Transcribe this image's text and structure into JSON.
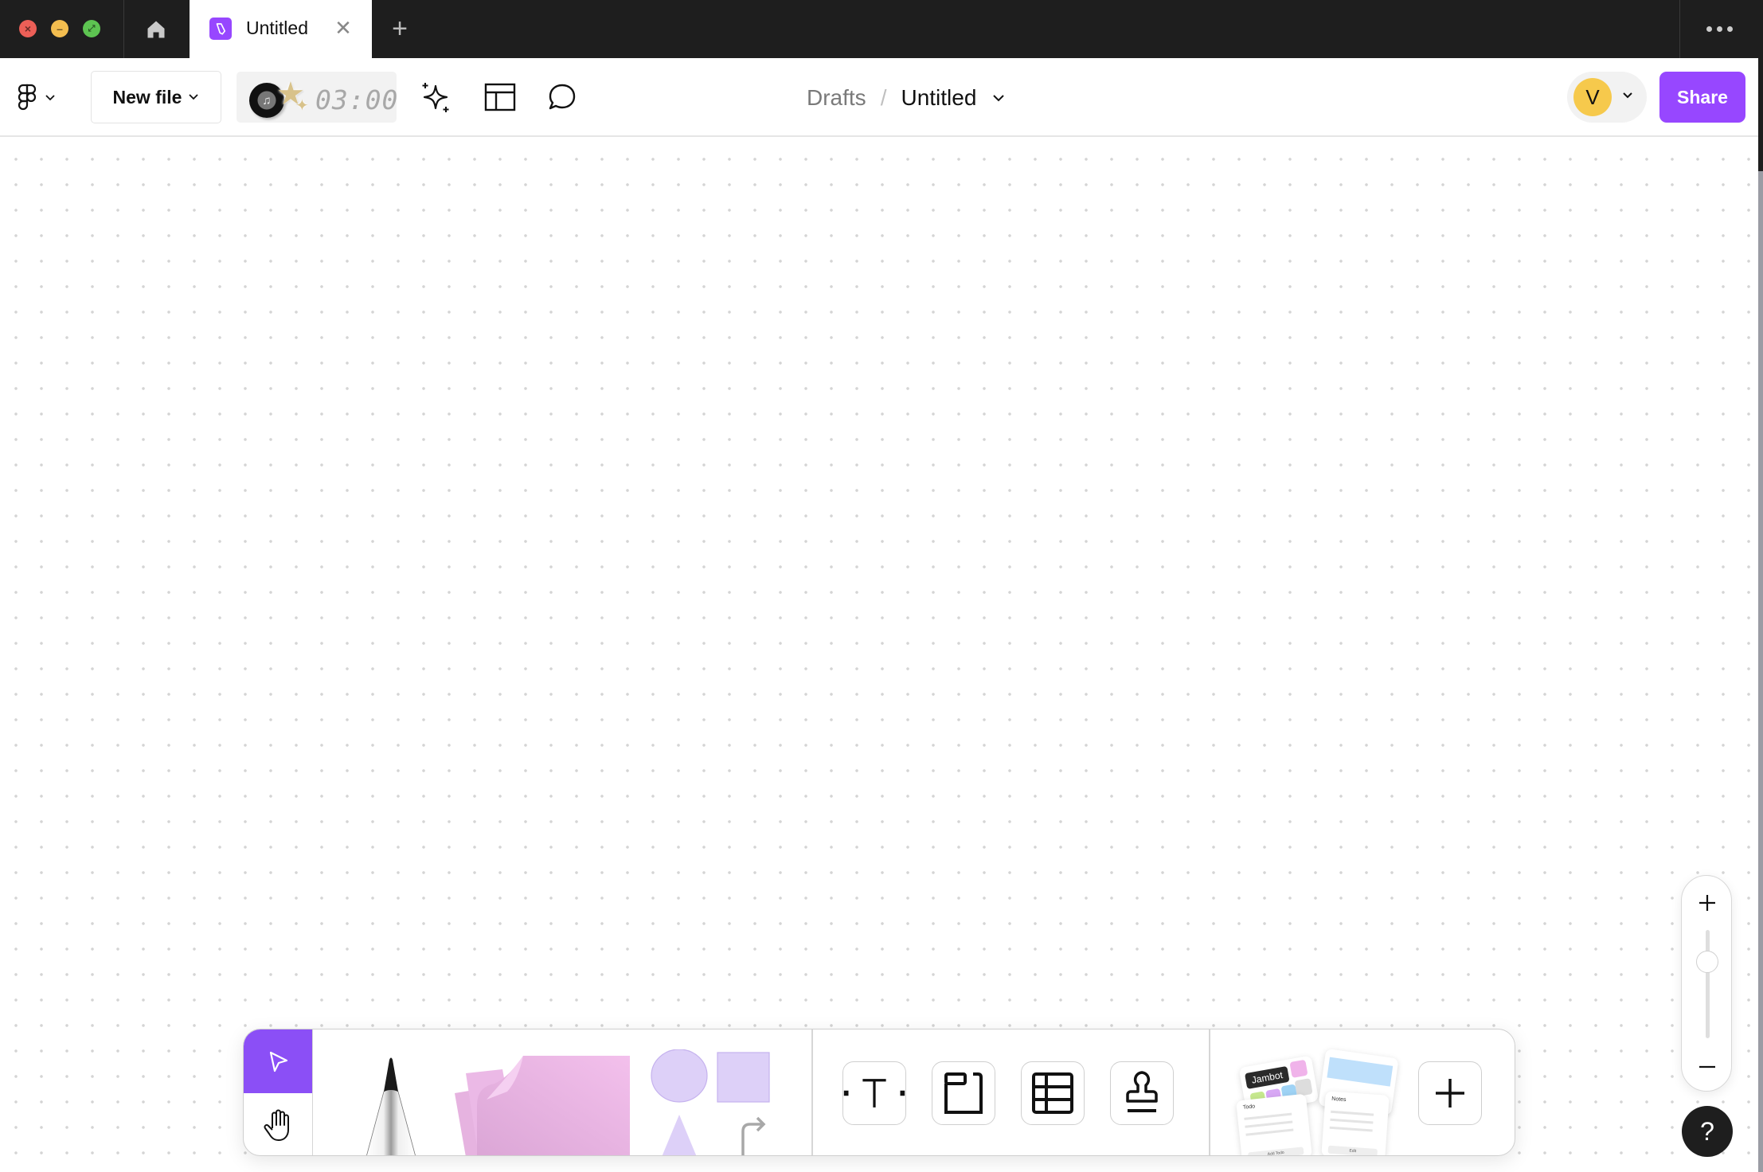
{
  "titlebar": {
    "window_controls": [
      "close",
      "minimize",
      "fullscreen"
    ],
    "home_icon": "home-icon",
    "active_tab": {
      "label": "Untitled",
      "icon": "figjam-file-icon",
      "close_glyph": "✕"
    },
    "new_tab_glyph": "+",
    "more_glyph": "•••"
  },
  "toolbar": {
    "main_menu_icon": "figma-logo-icon",
    "new_file_label": "New file",
    "timer": {
      "display": "03:00",
      "music_icon": "♫",
      "star": "★",
      "sparkle": "✦"
    },
    "ai_icon": "sparkles-icon",
    "templates_icon": "layout-icon",
    "comments_icon": "comment-icon",
    "breadcrumb": {
      "folder": "Drafts",
      "separator": "/",
      "file": "Untitled"
    },
    "user": {
      "initial": "V",
      "color": "#f6c94c"
    },
    "share_label": "Share",
    "accent_color": "#9747ff"
  },
  "dock": {
    "tools": [
      {
        "name": "Select",
        "active": true
      },
      {
        "name": "Hand"
      },
      {
        "name": "Marker"
      },
      {
        "name": "Sticky note"
      },
      {
        "name": "Shapes and connectors"
      },
      {
        "name": "Text"
      },
      {
        "name": "Section"
      },
      {
        "name": "Table"
      },
      {
        "name": "Stamp"
      },
      {
        "name": "Widgets"
      },
      {
        "name": "More"
      }
    ],
    "widgets_preview": {
      "jambot_label": "Jambot",
      "todo_title": "Todo",
      "todo_button": "Add Todo",
      "notes_title": "Notes",
      "notes_button": "Edit"
    }
  },
  "zoom": {
    "in_glyph": "+",
    "out_glyph": "−",
    "level_fraction": 0.25
  },
  "help": {
    "glyph": "?"
  }
}
